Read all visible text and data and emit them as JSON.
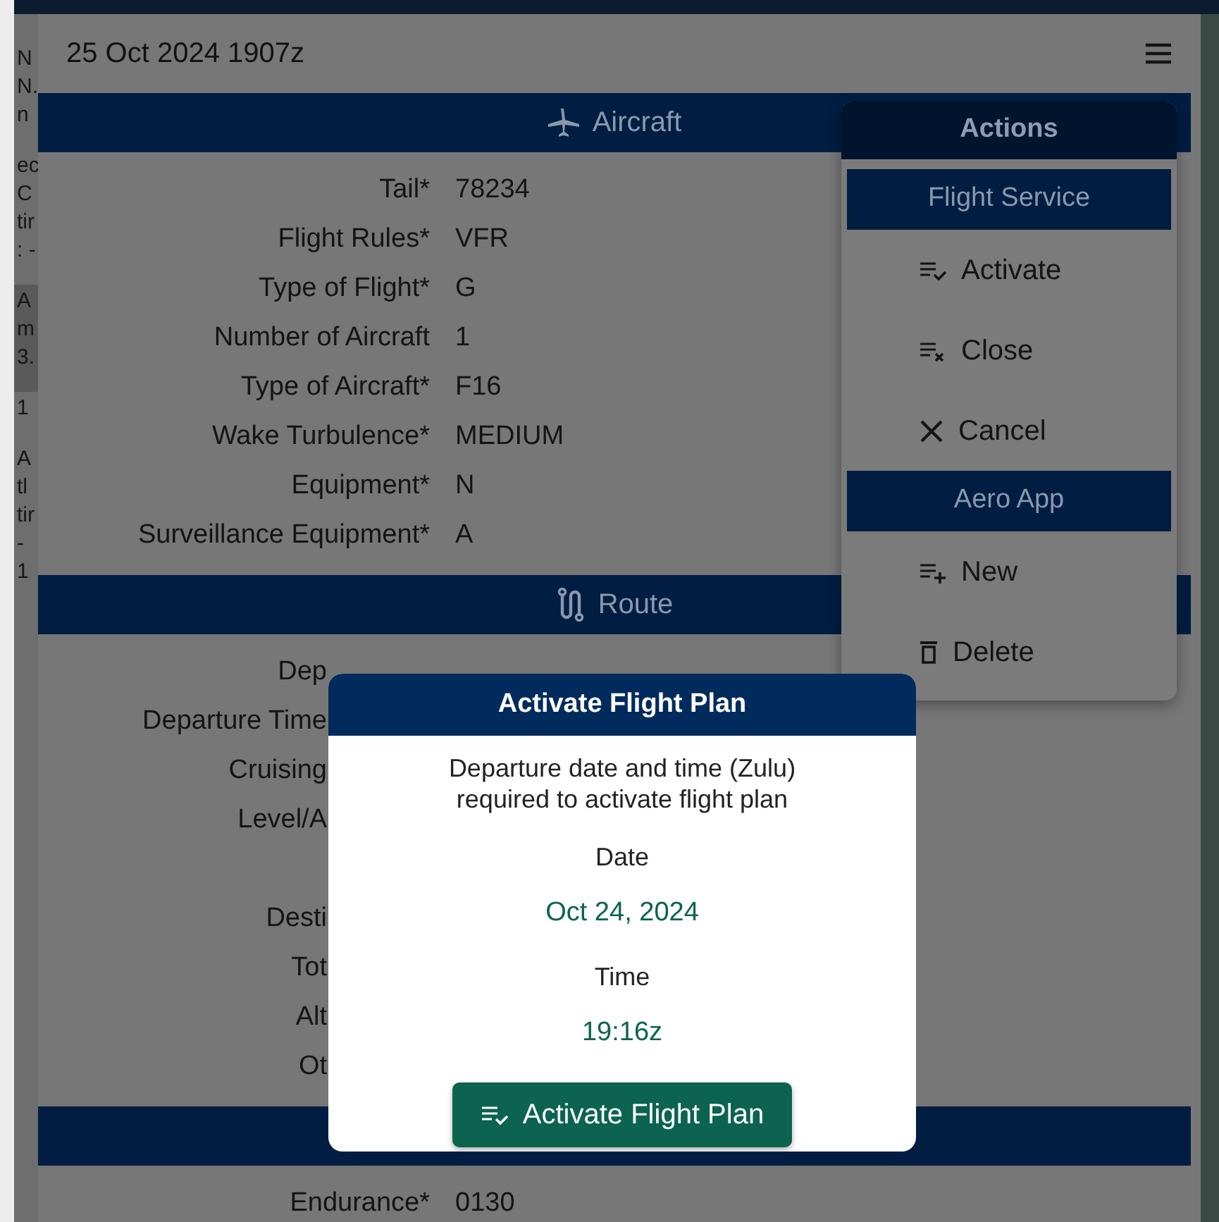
{
  "left_list": {
    "items": [
      {
        "lines": [
          "N",
          "N.",
          "n"
        ],
        "selected": false
      },
      {
        "lines": [
          "ec",
          "C",
          "tir",
          ": -"
        ],
        "selected": false
      },
      {
        "lines": [
          "A",
          "m",
          "3."
        ],
        "selected": true
      },
      {
        "lines": [
          "1"
        ],
        "selected": false
      },
      {
        "lines": [
          "A",
          "tl",
          "tir",
          "-",
          "1"
        ],
        "selected": false
      }
    ]
  },
  "sheet": {
    "title": "25 Oct 2024 1907z",
    "sections": [
      {
        "kind": "aircraft",
        "title": "Aircraft",
        "fields": [
          {
            "kind": "field",
            "label": "Tail*",
            "value": "78234"
          },
          {
            "kind": "field",
            "label": "Flight Rules*",
            "value": "VFR"
          },
          {
            "kind": "field",
            "label": "Type of Flight*",
            "value": "G"
          },
          {
            "kind": "field",
            "label": "Number of Aircraft",
            "value": "1"
          },
          {
            "kind": "field",
            "label": "Type of Aircraft*",
            "value": "F16"
          },
          {
            "kind": "field",
            "label": "Wake Turbulence*",
            "value": "MEDIUM"
          },
          {
            "kind": "field",
            "label": "Equipment*",
            "value": "N"
          },
          {
            "kind": "field",
            "label": "Surveillance Equipment*",
            "value": "A"
          }
        ]
      },
      {
        "kind": "route",
        "title": "Route",
        "fields": [
          {
            "kind": "partial",
            "label": "Dep"
          },
          {
            "kind": "partial",
            "label": "Departure Time"
          },
          {
            "kind": "partial",
            "label": "Cruising"
          },
          {
            "kind": "partial",
            "label": "Level/A"
          },
          {
            "kind": "spacer"
          },
          {
            "kind": "partial",
            "label": "Desti"
          },
          {
            "kind": "partial",
            "label": "Tot"
          },
          {
            "kind": "partial",
            "label": "Alt"
          },
          {
            "kind": "partial",
            "label": "Ot"
          }
        ]
      },
      {
        "kind": "plain",
        "fields": [
          {
            "kind": "field",
            "label": "Endurance*",
            "value": "0130"
          }
        ]
      }
    ]
  },
  "actions_menu": {
    "title": "Actions",
    "groups": [
      {
        "title": "Flight Service",
        "items": [
          {
            "kind": "activate",
            "label": "Activate"
          },
          {
            "kind": "close",
            "label": "Close"
          },
          {
            "kind": "cancel",
            "label": "Cancel"
          }
        ]
      },
      {
        "title": "Aero App",
        "items": [
          {
            "kind": "new",
            "label": "New"
          },
          {
            "kind": "delete",
            "label": "Delete"
          }
        ]
      }
    ]
  },
  "dialog": {
    "title": "Activate Flight Plan",
    "message": "Departure date and time (Zulu) required to activate flight plan",
    "date_label": "Date",
    "date_value": "Oct 24, 2024",
    "time_label": "Time",
    "time_value": "19:16z",
    "button": {
      "kind": "activate",
      "label": "Activate Flight Plan"
    }
  }
}
